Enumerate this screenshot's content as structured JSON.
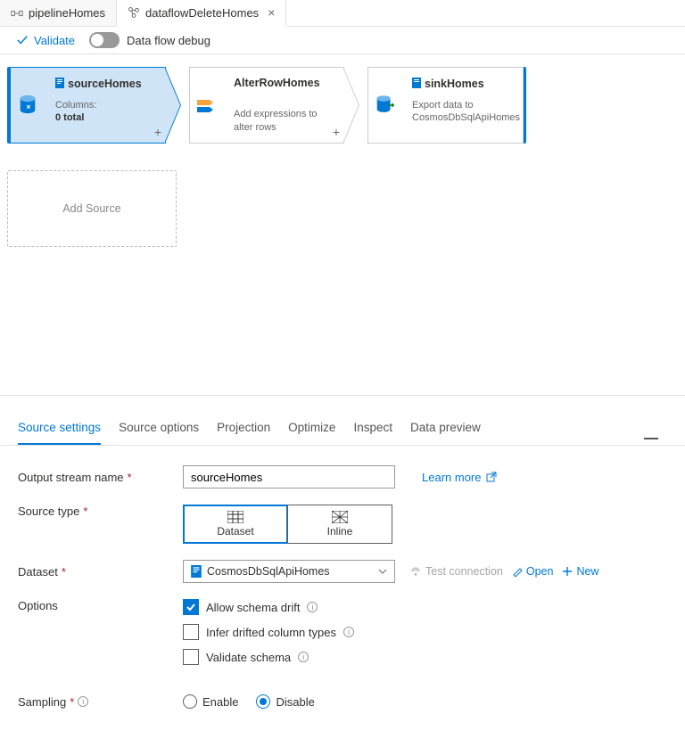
{
  "tabs": {
    "pipeline": "pipelineHomes",
    "dataflow": "dataflowDeleteHomes"
  },
  "toolbar": {
    "validate": "Validate",
    "debug": "Data flow debug"
  },
  "flow": {
    "source": {
      "title": "sourceHomes",
      "columns_label": "Columns:",
      "columns_value": "0 total"
    },
    "alter": {
      "title": "AlterRowHomes",
      "desc": "Add expressions to alter rows"
    },
    "sink": {
      "title": "sinkHomes",
      "desc1": "Export data to",
      "desc2": "CosmosDbSqlApiHomes"
    },
    "add_source": "Add Source"
  },
  "panel_tabs": {
    "t0": "Source settings",
    "t1": "Source options",
    "t2": "Projection",
    "t3": "Optimize",
    "t4": "Inspect",
    "t5": "Data preview"
  },
  "form": {
    "output_stream_label": "Output stream name",
    "output_stream_value": "sourceHomes",
    "learn_more": "Learn more",
    "source_type_label": "Source type",
    "seg_dataset": "Dataset",
    "seg_inline": "Inline",
    "dataset_label": "Dataset",
    "dataset_value": "CosmosDbSqlApiHomes",
    "test_conn": "Test connection",
    "open": "Open",
    "new": "New",
    "options_label": "Options",
    "opt_schema_drift": "Allow schema drift",
    "opt_infer": "Infer drifted column types",
    "opt_validate": "Validate schema",
    "sampling_label": "Sampling",
    "sampling_enable": "Enable",
    "sampling_disable": "Disable"
  }
}
